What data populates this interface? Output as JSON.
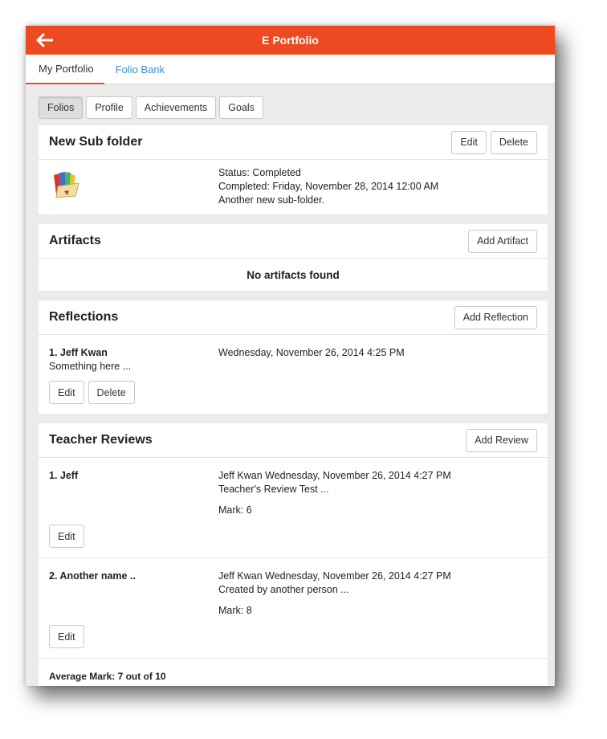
{
  "colors": {
    "accent": "#ee4a22",
    "link": "#3a8fc7"
  },
  "header": {
    "title": "E Portfolio",
    "back_icon": "arrow-left-icon"
  },
  "tabs": {
    "my_portfolio": "My Portfolio",
    "folio_bank": "Folio Bank"
  },
  "segments": {
    "folios": "Folios",
    "profile": "Profile",
    "achievements": "Achievements",
    "goals": "Goals"
  },
  "folder": {
    "title": "New Sub folder",
    "edit": "Edit",
    "delete": "Delete",
    "icon": "folder-icon",
    "status": "Status: Completed",
    "completed": "Completed: Friday, November 28, 2014 12:00 AM",
    "description": "Another new sub-folder."
  },
  "artifacts": {
    "title": "Artifacts",
    "add": "Add Artifact",
    "empty": "No artifacts found"
  },
  "reflections": {
    "title": "Reflections",
    "add": "Add Reflection",
    "items": [
      {
        "name": "1. Jeff Kwan",
        "date": "Wednesday, November 26, 2014 4:25 PM",
        "text": "Something here ...",
        "edit": "Edit",
        "delete": "Delete"
      }
    ]
  },
  "reviews": {
    "title": "Teacher Reviews",
    "add": "Add Review",
    "items": [
      {
        "name": "1. Jeff",
        "meta": "Jeff Kwan Wednesday, November 26, 2014 4:27 PM",
        "text": "Teacher's Review Test ...",
        "mark": "Mark: 6",
        "edit": "Edit"
      },
      {
        "name": "2. Another name ..",
        "meta": "Jeff Kwan Wednesday, November 26, 2014 4:27 PM",
        "text": "Created by another person ...",
        "mark": "Mark: 8",
        "edit": "Edit"
      }
    ],
    "average": "Average Mark: 7 out of 10"
  }
}
